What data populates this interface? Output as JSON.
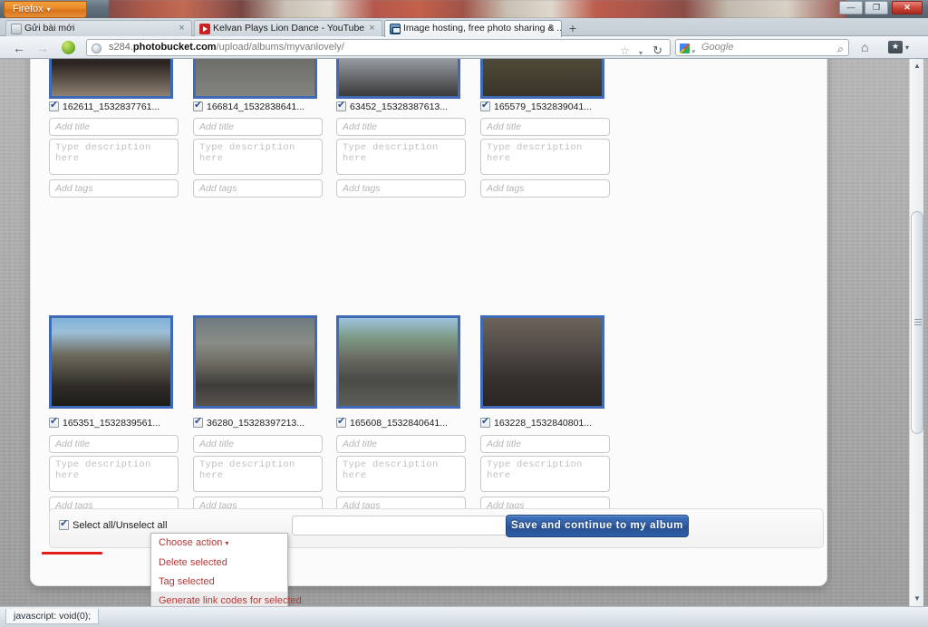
{
  "window": {
    "app_button": "Firefox",
    "app_caret": "▾",
    "minimize": "—",
    "maximize": "❐",
    "close": "✕"
  },
  "tabs": [
    {
      "title": "Gửi bài mới",
      "favicon": "document-icon",
      "close": "×",
      "active": false
    },
    {
      "title": "Kelvan Plays Lion Dance - YouTube",
      "favicon": "youtube-icon",
      "close": "×",
      "active": false
    },
    {
      "title": "Image hosting, free photo sharing & ...",
      "favicon": "photobucket-icon",
      "close": "×",
      "active": true
    }
  ],
  "new_tab_label": "+",
  "navbar": {
    "back": "←",
    "forward": "→",
    "stop": "stop-icon",
    "url_prefix": "s284.",
    "url_domain": "photobucket.com",
    "url_path": "/upload/albums/myvanlovely/",
    "star": "☆",
    "dropmarker": "▾",
    "reload": "↻",
    "search_engine": "Google",
    "search_caret": "▾",
    "search_glass": "⌕",
    "home": "⌂",
    "bookmark_caret": "▾"
  },
  "grid": {
    "rows": [
      {
        "cells": [
          {
            "filename": "162611_1532837761...",
            "checked": true,
            "title_placeholder": "Add title",
            "desc_placeholder": "Type description here",
            "tags_placeholder": "Add tags"
          },
          {
            "filename": "166814_1532838641...",
            "checked": true,
            "title_placeholder": "Add title",
            "desc_placeholder": "Type description here",
            "tags_placeholder": "Add tags"
          },
          {
            "filename": "63452_15328387613...",
            "checked": true,
            "title_placeholder": "Add title",
            "desc_placeholder": "Type description here",
            "tags_placeholder": "Add tags"
          },
          {
            "filename": "165579_1532839041...",
            "checked": true,
            "title_placeholder": "Add title",
            "desc_placeholder": "Type description here",
            "tags_placeholder": "Add tags"
          }
        ]
      },
      {
        "cells": [
          {
            "filename": "165351_1532839561...",
            "checked": true,
            "title_placeholder": "Add title",
            "desc_placeholder": "Type description here",
            "tags_placeholder": "Add tags"
          },
          {
            "filename": "36280_15328397213...",
            "checked": true,
            "title_placeholder": "Add title",
            "desc_placeholder": "Type description here",
            "tags_placeholder": "Add tags"
          },
          {
            "filename": "165608_1532840641...",
            "checked": true,
            "title_placeholder": "Add title",
            "desc_placeholder": "Type description here",
            "tags_placeholder": "Add tags"
          },
          {
            "filename": "163228_1532840801...",
            "checked": true,
            "title_placeholder": "Add title",
            "desc_placeholder": "Type description here",
            "tags_placeholder": "Add tags"
          }
        ]
      }
    ]
  },
  "actionbar": {
    "select_all_label": "Select all/Unselect all",
    "select_all_checked": true,
    "save_button": "Save and continue to my album"
  },
  "dropdown": {
    "toggle_label": "Choose action",
    "toggle_caret": "▾",
    "items": [
      {
        "label": "Delete selected",
        "hovered": false
      },
      {
        "label": "Tag selected",
        "hovered": false
      },
      {
        "label": "Generate link codes for selected",
        "hovered": true
      }
    ]
  },
  "statusbar": {
    "text": "javascript: void(0);"
  },
  "colors": {
    "accent_red": "#b03a3a",
    "underline_red": "#e02020",
    "save_blue": "#2f5da6",
    "thumb_border_blue": "#3f6ab5"
  }
}
